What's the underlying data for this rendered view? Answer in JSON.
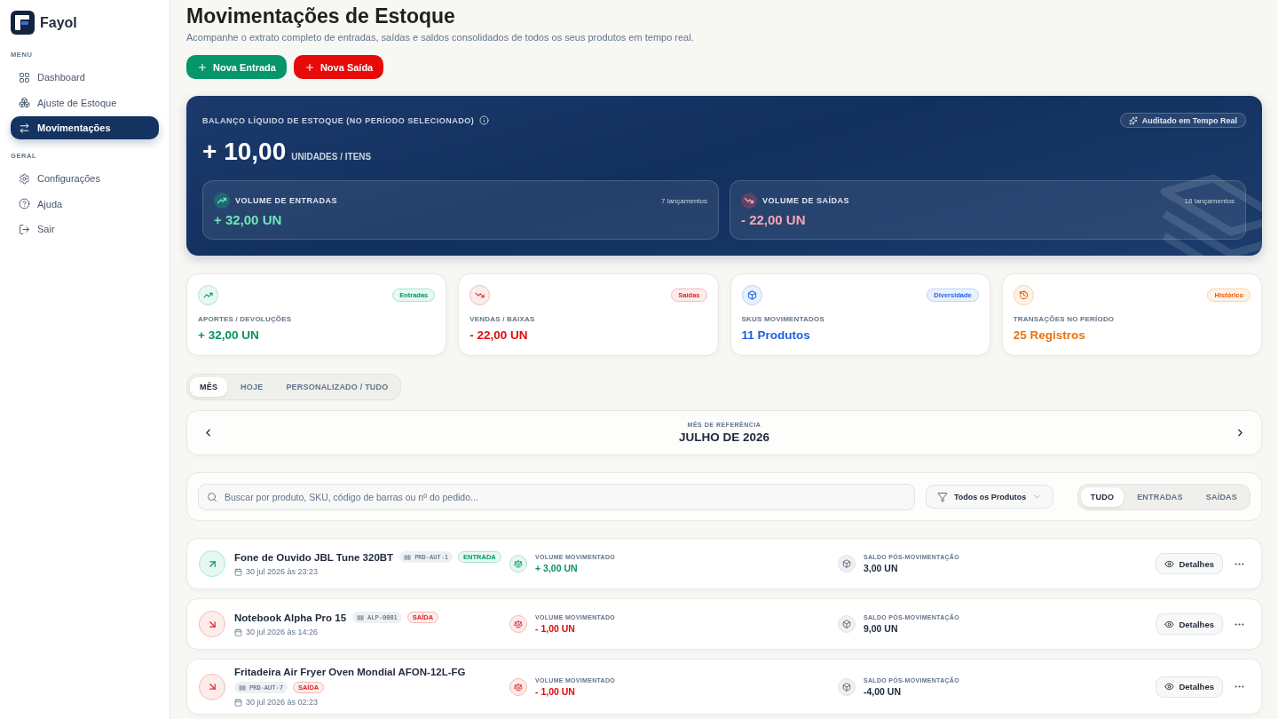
{
  "sidebar": {
    "brand": "Fayol",
    "sections": [
      {
        "title": "MENU",
        "items": [
          {
            "label": "Dashboard",
            "selected": false
          },
          {
            "label": "Ajuste de Estoque",
            "selected": false
          },
          {
            "label": "Movimentações",
            "selected": true
          }
        ]
      },
      {
        "title": "GERAL",
        "items": [
          {
            "label": "Configurações",
            "selected": false
          },
          {
            "label": "Ajuda",
            "selected": false
          },
          {
            "label": "Sair",
            "selected": false
          }
        ]
      }
    ]
  },
  "header": {
    "title": "Movimentações de Estoque",
    "subtitle": "Acompanhe o extrato completo de entradas, saídas e saldos consolidados de todos os seus produtos em tempo real.",
    "actions": [
      {
        "label": "Nova Entrada",
        "kind": "entry"
      },
      {
        "label": "Nova Saída",
        "kind": "exit"
      }
    ]
  },
  "balance": {
    "title": "BALANÇO LÍQUIDO DE ESTOQUE (NO PERÍODO SELECIONADO)",
    "badge": "Auditado em Tempo Real",
    "value": "+ 10,00",
    "unit": "UNIDADES / ITENS",
    "volumes": [
      {
        "kind": "in",
        "label": "VOLUME DE ENTRADAS",
        "count": "7 lançamentos",
        "value": "+ 32,00 UN"
      },
      {
        "kind": "out",
        "label": "VOLUME DE SAÍDAS",
        "count": "18 lançamentos",
        "value": "- 22,00 UN"
      }
    ]
  },
  "stats": [
    {
      "kind": "in",
      "tag": "Entradas",
      "label": "APORTES / DEVOLUÇÕES",
      "value": "+ 32,00 UN"
    },
    {
      "kind": "out",
      "tag": "Saídas",
      "label": "VENDAS / BAIXAS",
      "value": "- 22,00 UN"
    },
    {
      "kind": "sku",
      "tag": "Diversidade",
      "label": "SKUS MOVIMENTADOS",
      "value": "11 Produtos"
    },
    {
      "kind": "history",
      "tag": "Histórico",
      "label": "TRANSAÇÕES NO PERÍODO",
      "value": "25 Registros"
    }
  ],
  "period_tabs": [
    {
      "label": "MÊS",
      "selected": true
    },
    {
      "label": "HOJE",
      "selected": false
    },
    {
      "label": "PERSONALIZADO / TUDO",
      "selected": false
    }
  ],
  "month_nav": {
    "caption": "MÊS DE REFERÊNCIA",
    "value": "JULHO DE 2026"
  },
  "filters": {
    "search": {
      "placeholder": "Buscar por produto, SKU, código de barras ou nº do pedido..."
    },
    "product_filter": "Todos os Produtos",
    "type_tabs": [
      {
        "label": "TUDO",
        "selected": true
      },
      {
        "label": "ENTRADAS",
        "selected": false
      },
      {
        "label": "SAÍDAS",
        "selected": false
      }
    ]
  },
  "movements": [
    {
      "kind": "in",
      "name": "Fone de Ouvido JBL Tune 320BT",
      "sku": "PRD-AUT-1",
      "type_badge": "ENTRADA",
      "date": "30 jul 2026 às 23:23",
      "volume_label": "VOLUME MOVIMENTADO",
      "volume": "+ 3,00 UN",
      "balance_label": "SALDO PÓS-MOVIMENTAÇÃO",
      "balance": "3,00 UN",
      "action": "Detalhes"
    },
    {
      "kind": "out",
      "name": "Notebook Alpha Pro 15",
      "sku": "ALP-0001",
      "type_badge": "SAÍDA",
      "date": "30 jul 2026 às 14:26",
      "volume_label": "VOLUME MOVIMENTADO",
      "volume": "- 1,00 UN",
      "balance_label": "SALDO PÓS-MOVIMENTAÇÃO",
      "balance": "9,00 UN",
      "action": "Detalhes"
    },
    {
      "kind": "out",
      "name": "Fritadeira Air Fryer Oven Mondial AFON-12L-FG",
      "sku": "PRD-AUT-7",
      "type_badge": "SAÍDA",
      "date": "30 jul 2026 às 02:23",
      "volume_label": "VOLUME MOVIMENTADO",
      "volume": "- 1,00 UN",
      "balance_label": "SALDO PÓS-MOVIMENTAÇÃO",
      "balance": "-4,00 UN",
      "action": "Detalhes"
    }
  ]
}
